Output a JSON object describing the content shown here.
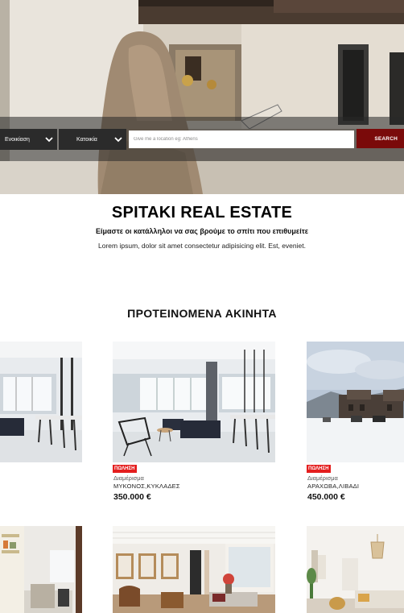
{
  "search": {
    "type_label": "Ενοικίαση",
    "category_label": "Κατοικία",
    "location_placeholder": "Give me a location eg: Athens",
    "button_label": "SEARCH"
  },
  "intro": {
    "title": "SPITAKI REAL ESTATE",
    "subtitle": "Είμαστε οι κατάλληλοι να σας βρούμε το σπίτι που επιθυμείτε",
    "description": "Lorem ipsum, dolor sit amet consectetur adipisicing elit. Est, eveniet."
  },
  "featured": {
    "title": "ΠΡΟΤΕΙΝΟΜΕΝΑ ΑΚΙΝΗΤΑ",
    "listings": [
      {
        "badge": "ΠΩΛΗΣΗ",
        "type": "Διαμέρισμα",
        "location": "ΜΥΚΟΝΟΣ,ΚΥΚΛΑΔΕΣ",
        "price": "350.000 €"
      },
      {
        "badge": "ΠΩΛΗΣΗ",
        "type": "Διαμέρισμα",
        "location": "ΑΡΑΧΩΒΑ,ΛΙΒΑΔΙ",
        "price": "450.000 €"
      }
    ]
  },
  "colors": {
    "search_button": "#7a0a0a",
    "badge": "#e41e1e",
    "search_bar_overlay": "rgba(40,40,40,0.55)"
  },
  "icons": {
    "dropdown": "chevron-down-icon"
  }
}
